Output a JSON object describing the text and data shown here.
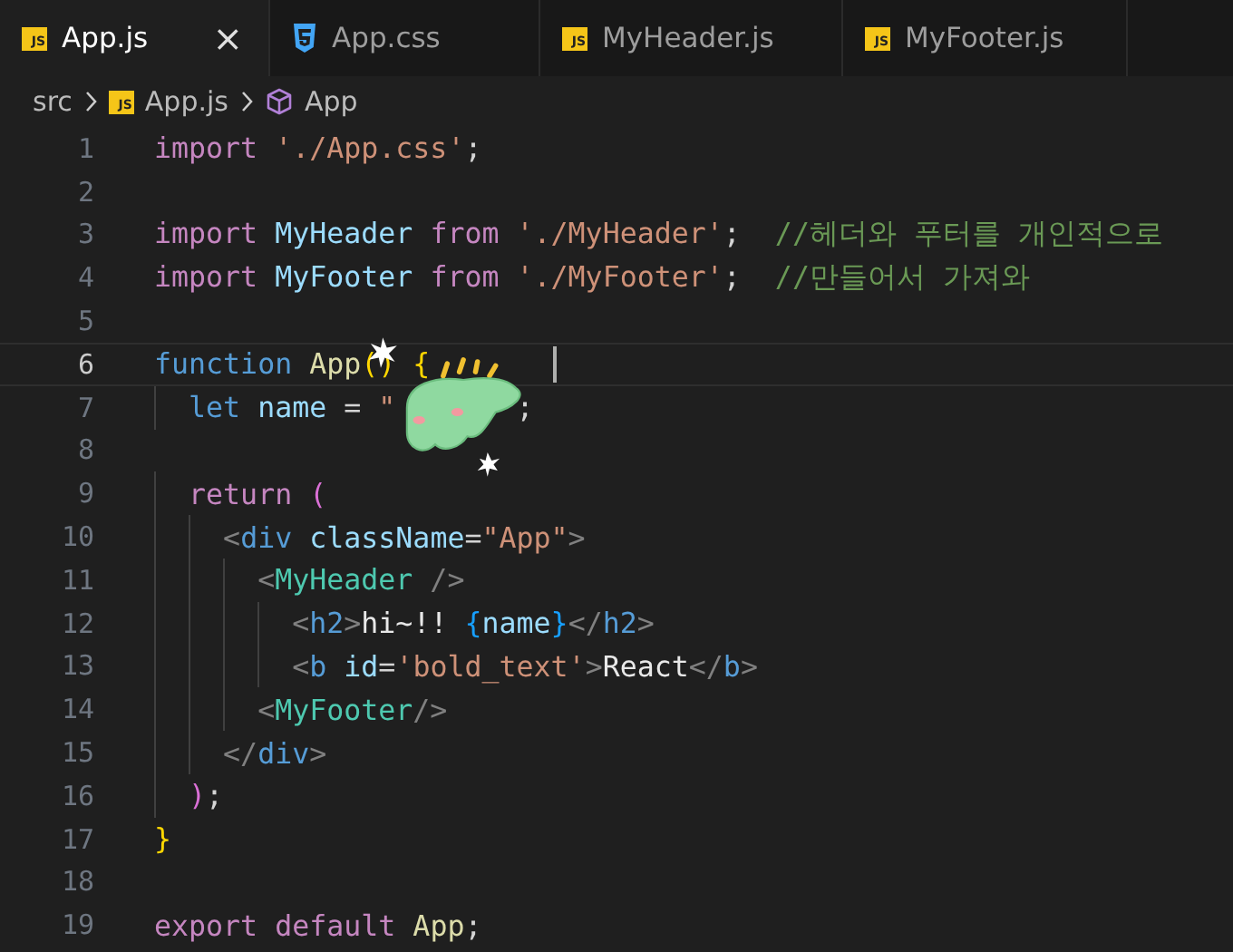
{
  "tabs": [
    {
      "label": "App.js",
      "kind": "js",
      "badge": "JS",
      "selected": true,
      "close": "×"
    },
    {
      "label": "App.css",
      "kind": "css",
      "selected": false
    },
    {
      "label": "MyHeader.js",
      "kind": "js",
      "badge": "JS",
      "selected": false
    },
    {
      "label": "MyFooter.js",
      "kind": "js",
      "badge": "JS",
      "selected": false
    }
  ],
  "breadcrumb": [
    {
      "label": "src",
      "kind": "folder"
    },
    {
      "label": "App.js",
      "kind": "js",
      "badge": "JS"
    },
    {
      "label": "App",
      "kind": "symbol"
    }
  ],
  "lines": [
    {
      "number": "1",
      "current": false,
      "tokens": [
        {
          "text": "import",
          "kind": "keyword"
        },
        {
          "text": " './App.css'",
          "kind": "string"
        },
        {
          "text": ";",
          "kind": "punctuation"
        }
      ]
    },
    {
      "number": "2",
      "current": false
    },
    {
      "number": "3",
      "current": false,
      "tokens": [
        {
          "text": "import",
          "kind": "keyword"
        },
        {
          "text": " MyHeader",
          "kind": "identifier"
        },
        {
          "text": " from",
          "kind": "keyword"
        },
        {
          "text": " './MyHeader'",
          "kind": "string"
        },
        {
          "text": ";",
          "kind": "punctuation"
        },
        {
          "text": "  //헤더와 푸터를 개인적으로",
          "kind": "comment"
        }
      ]
    },
    {
      "number": "4",
      "current": false,
      "tokens": [
        {
          "text": "import",
          "kind": "keyword"
        },
        {
          "text": " MyFooter",
          "kind": "identifier"
        },
        {
          "text": " from",
          "kind": "keyword"
        },
        {
          "text": " './MyFooter'",
          "kind": "string"
        },
        {
          "text": ";",
          "kind": "punctuation"
        },
        {
          "text": "  //만들어서 가져와",
          "kind": "comment"
        }
      ]
    },
    {
      "number": "5",
      "current": false
    },
    {
      "number": "6",
      "current": true,
      "tokens": [
        {
          "text": "function",
          "kind": "declaration"
        },
        {
          "text": " App",
          "kind": "function"
        },
        {
          "text": "()",
          "kind": "bracketgold"
        },
        {
          "text": " {",
          "kind": "bracketgold"
        }
      ]
    },
    {
      "number": "7",
      "current": false,
      "tokens": [
        {
          "text": "  let",
          "kind": "declaration"
        },
        {
          "text": " name",
          "kind": "identifier"
        },
        {
          "text": " =",
          "kind": "punctuation"
        },
        {
          "text": " \"",
          "kind": "string"
        },
        {
          "text": "       ;",
          "kind": "punctuation"
        }
      ]
    },
    {
      "number": "8",
      "current": false
    },
    {
      "number": "9",
      "current": false,
      "tokens": [
        {
          "text": "  return",
          "kind": "keyword"
        },
        {
          "text": " (",
          "kind": "bracketpink"
        }
      ]
    },
    {
      "number": "10",
      "current": false,
      "tokens": [
        {
          "text": "    <",
          "kind": "angle"
        },
        {
          "text": "div",
          "kind": "tag"
        },
        {
          "text": " className",
          "kind": "identifier"
        },
        {
          "text": "=",
          "kind": "punctuation"
        },
        {
          "text": "\"App\"",
          "kind": "string"
        },
        {
          "text": ">",
          "kind": "angle"
        }
      ]
    },
    {
      "number": "11",
      "current": false,
      "tokens": [
        {
          "text": "      <",
          "kind": "angle"
        },
        {
          "text": "MyHeader",
          "kind": "component"
        },
        {
          "text": " />",
          "kind": "angle"
        }
      ]
    },
    {
      "number": "12",
      "current": false,
      "tokens": [
        {
          "text": "        <",
          "kind": "angle"
        },
        {
          "text": "h2",
          "kind": "tag"
        },
        {
          "text": ">",
          "kind": "angle"
        },
        {
          "text": "hi~!! ",
          "kind": "text"
        },
        {
          "text": "{",
          "kind": "bracketblue"
        },
        {
          "text": "name",
          "kind": "identifier"
        },
        {
          "text": "}",
          "kind": "bracketblue"
        },
        {
          "text": "</",
          "kind": "angle"
        },
        {
          "text": "h2",
          "kind": "tag"
        },
        {
          "text": ">",
          "kind": "angle"
        }
      ]
    },
    {
      "number": "13",
      "current": false,
      "tokens": [
        {
          "text": "        <",
          "kind": "angle"
        },
        {
          "text": "b",
          "kind": "tag"
        },
        {
          "text": " id",
          "kind": "identifier"
        },
        {
          "text": "=",
          "kind": "punctuation"
        },
        {
          "text": "'bold_text'",
          "kind": "string"
        },
        {
          "text": ">",
          "kind": "angle"
        },
        {
          "text": "React",
          "kind": "text"
        },
        {
          "text": "</",
          "kind": "angle"
        },
        {
          "text": "b",
          "kind": "tag"
        },
        {
          "text": ">",
          "kind": "angle"
        }
      ]
    },
    {
      "number": "14",
      "current": false,
      "tokens": [
        {
          "text": "      <",
          "kind": "angle"
        },
        {
          "text": "MyFooter",
          "kind": "component"
        },
        {
          "text": "/>",
          "kind": "angle"
        }
      ]
    },
    {
      "number": "15",
      "current": false,
      "tokens": [
        {
          "text": "    </",
          "kind": "angle"
        },
        {
          "text": "div",
          "kind": "tag"
        },
        {
          "text": ">",
          "kind": "angle"
        }
      ]
    },
    {
      "number": "16",
      "current": false,
      "tokens": [
        {
          "text": "  )",
          "kind": "bracketpink"
        },
        {
          "text": ";",
          "kind": "punctuation"
        }
      ]
    },
    {
      "number": "17",
      "current": false,
      "tokens": [
        {
          "text": "}",
          "kind": "bracketgold"
        }
      ]
    },
    {
      "number": "18",
      "current": false
    },
    {
      "number": "19",
      "current": false,
      "tokens": [
        {
          "text": "export",
          "kind": "keyword"
        },
        {
          "text": " default",
          "kind": "keyword"
        },
        {
          "text": " App",
          "kind": "function"
        },
        {
          "text": ";",
          "kind": "punctuation"
        }
      ]
    }
  ]
}
